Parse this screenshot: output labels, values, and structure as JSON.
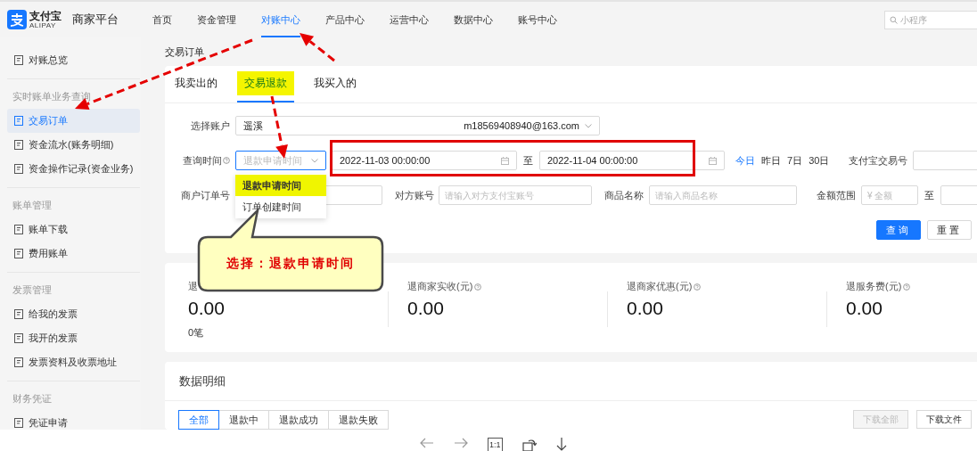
{
  "header": {
    "logo_text": "支付宝",
    "logo_subtext": "ALIPAY",
    "platform": "商家平台",
    "nav": [
      {
        "label": "首页",
        "selected": false
      },
      {
        "label": "资金管理",
        "selected": false
      },
      {
        "label": "对账中心",
        "selected": true
      },
      {
        "label": "产品中心",
        "selected": false
      },
      {
        "label": "运营中心",
        "selected": false
      },
      {
        "label": "数据中心",
        "selected": false
      },
      {
        "label": "账号中心",
        "selected": false
      }
    ],
    "search": {
      "placeholder": "小程序"
    }
  },
  "sidebar": {
    "groups": [
      {
        "items": [
          {
            "label": "对账总览",
            "selected": false
          }
        ]
      },
      {
        "title": "实时账单业务查询",
        "items": [
          {
            "label": "交易订单",
            "selected": true
          },
          {
            "label": "资金流水(账务明细)",
            "selected": false
          },
          {
            "label": "资金操作记录(资金业务)",
            "selected": false
          }
        ]
      },
      {
        "title": "账单管理",
        "items": [
          {
            "label": "账单下载",
            "selected": false
          },
          {
            "label": "费用账单",
            "selected": false
          }
        ]
      },
      {
        "title": "发票管理",
        "items": [
          {
            "label": "给我的发票",
            "selected": false
          },
          {
            "label": "我开的发票",
            "selected": false
          },
          {
            "label": "发票资料及收票地址",
            "selected": false
          }
        ]
      },
      {
        "title": "财务凭证",
        "items": [
          {
            "label": "凭证申请",
            "selected": false
          }
        ]
      }
    ]
  },
  "breadcrumb": "交易订单",
  "tabs": [
    {
      "label": "我卖出的",
      "selected": false,
      "highlighted": false
    },
    {
      "label": "交易退款",
      "selected": true,
      "highlighted": true
    },
    {
      "label": "我买入的",
      "selected": false,
      "highlighted": false
    }
  ],
  "filters": {
    "account": {
      "label": "选择账户",
      "name": "遥溪",
      "email": "m18569408940@163.com"
    },
    "time": {
      "label": "查询时间",
      "placeholder": "退款申请时间",
      "expanded": true,
      "options": [
        {
          "label": "退款申请时间",
          "selected": true,
          "highlighted": true
        },
        {
          "label": "订单创建时间",
          "selected": false,
          "highlighted": false
        }
      ],
      "start": "2022-11-03 00:00:00",
      "separator": "至",
      "end": "2022-11-04 00:00:00",
      "quick": [
        {
          "label": "今日",
          "selected": true
        },
        {
          "label": "昨日",
          "selected": false
        },
        {
          "label": "7日",
          "selected": false
        },
        {
          "label": "30日",
          "selected": false
        }
      ]
    },
    "trade_no": {
      "label": "支付宝交易号"
    },
    "merchant_order": {
      "label": "商户订单号"
    },
    "counterparty": {
      "label": "对方账号",
      "placeholder": "请输入对方支付宝账号"
    },
    "product": {
      "label": "商品名称",
      "placeholder": "请输入商品名称"
    },
    "amount": {
      "label": "金额范围",
      "placeholder": "¥ 全额",
      "separator": "至"
    },
    "buttons": [
      {
        "label": "查询",
        "kind": "primary"
      },
      {
        "label": "重置",
        "kind": "default"
      }
    ]
  },
  "stats": [
    {
      "label": "退",
      "value": "0.00",
      "count": "0笔"
    },
    {
      "label": "退商家实收(元)",
      "help": true,
      "value": "0.00"
    },
    {
      "label": "退商家优惠(元)",
      "help": true,
      "value": "0.00"
    },
    {
      "label": "退服务费(元)",
      "help": true,
      "value": "0.00"
    }
  ],
  "details": {
    "title": "数据明细",
    "status_tabs": [
      {
        "label": "全部",
        "selected": true
      },
      {
        "label": "退款中",
        "selected": false
      },
      {
        "label": "退款成功",
        "selected": false
      },
      {
        "label": "退款失败",
        "selected": false
      }
    ],
    "buttons": [
      {
        "label": "下载全部",
        "disabled": true
      },
      {
        "label": "下载文件",
        "disabled": false
      }
    ]
  },
  "annotations": {
    "callout": "选择：退款申请时间"
  },
  "viewer": {
    "actual_size": "1:1"
  }
}
